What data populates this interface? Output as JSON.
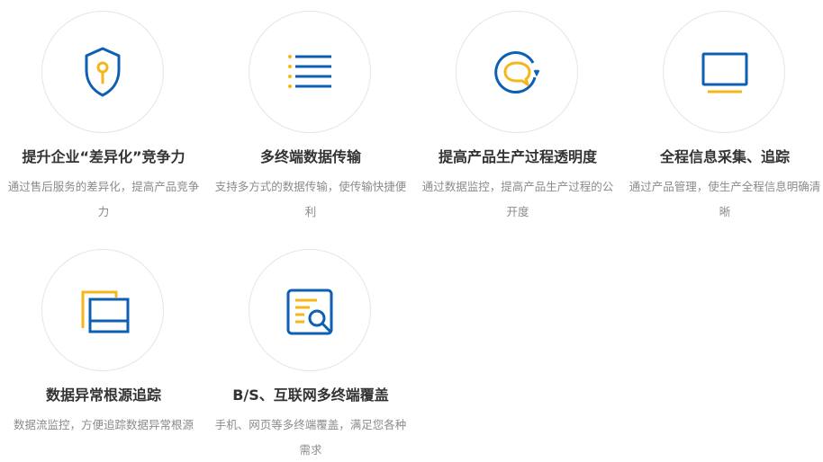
{
  "colors": {
    "blue": "#0d5fb3",
    "yellow": "#f6b51b",
    "circle_border": "#e5e5e5",
    "title": "#333333",
    "desc": "#8b8b8b"
  },
  "features": [
    {
      "icon": "shield-keyhole-icon",
      "title": "提升企业“差异化”竞争力",
      "desc": "通过售后服务的差异化，提高产品竞争力"
    },
    {
      "icon": "list-lines-icon",
      "title": "多终端数据传输",
      "desc": "支持多方式的数据传输，使传输快捷便利"
    },
    {
      "icon": "chat-bubble-circle-icon",
      "title": "提高产品生产过程透明度",
      "desc": "通过数据监控，提高产品生产过程的公开度"
    },
    {
      "icon": "monitor-icon",
      "title": "全程信息采集、追踪",
      "desc": "通过产品管理，使生产全程信息明确清晰"
    },
    {
      "icon": "stacked-windows-icon",
      "title": "数据异常根源追踪",
      "desc": "数据流监控，方便追踪数据异常根源"
    },
    {
      "icon": "document-search-icon",
      "title": "B/S、互联网多终端覆盖",
      "desc": "手机、网页等多终端覆盖，满足您各种需求"
    }
  ]
}
